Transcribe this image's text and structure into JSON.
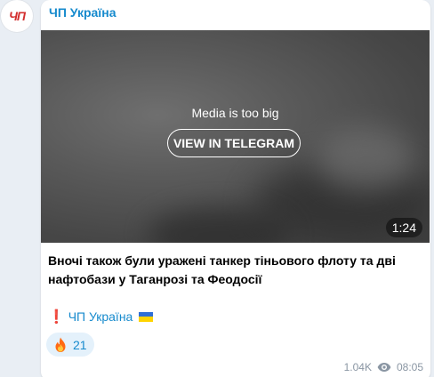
{
  "channel": {
    "name": "ЧП Україна",
    "avatar_text": "ЧП"
  },
  "media": {
    "notice": "Media is too big",
    "button_label": "VIEW IN TELEGRAM",
    "duration": "1:24"
  },
  "post": {
    "text": "Вночі також були уражені танкер тіньового флоту та дві нафтобази у Таганрозі та Феодосії",
    "signature_mark": "❗",
    "signature_link": "ЧП Україна",
    "signature_flag_icon": "ukraine-flag-icon"
  },
  "reaction": {
    "icon": "fire-icon",
    "count": "21"
  },
  "footer": {
    "views": "1.04K",
    "views_icon": "eye-icon",
    "time": "08:05"
  },
  "colors": {
    "accent": "#168acd",
    "background": "#e9eef4",
    "bubble": "#ffffff",
    "reaction_bg": "#e4f1fb",
    "meta": "#8a96a3"
  }
}
